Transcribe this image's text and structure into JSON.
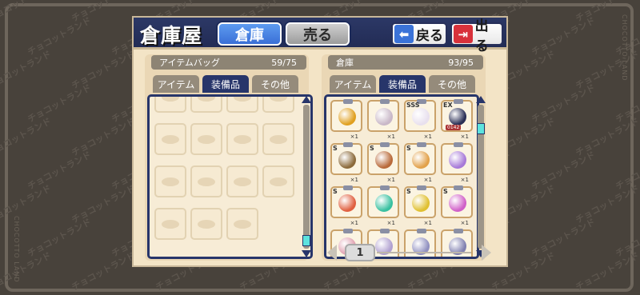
{
  "header": {
    "title": "倉庫屋",
    "tab_warehouse": "倉庫",
    "tab_sell": "売る",
    "back_label": "戻る",
    "exit_label": "出る"
  },
  "watermark": {
    "text": "チョコットランド",
    "side_text": "CHOCOTTO LAND"
  },
  "bag": {
    "title": "アイテムバッグ",
    "count": "59/75",
    "tabs": [
      "アイテム",
      "装備品",
      "その他"
    ],
    "active_tab": "装備品",
    "empty_slots": 15
  },
  "storage": {
    "title": "倉庫",
    "count": "93/95",
    "tabs": [
      "アイテム",
      "装備品",
      "その他"
    ],
    "active_tab": "装備品",
    "items": [
      {
        "rank": "",
        "qty": "×1",
        "icon": "torii-gate-icon",
        "color": "#e0a020"
      },
      {
        "rank": "",
        "qty": "×1",
        "icon": "horned-helmet-icon",
        "color": "#c9b8c8"
      },
      {
        "rank": "SSS",
        "qty": "×1",
        "icon": "white-creature-icon",
        "color": "#e8e0ee"
      },
      {
        "rank": "EX",
        "qty": "×1",
        "sub": "0142",
        "icon": "black-wing-icon",
        "color": "#2a2f55"
      },
      {
        "rank": "S",
        "qty": "×1",
        "icon": "branch-weapon-icon",
        "color": "#8c6b3c"
      },
      {
        "rank": "S",
        "qty": "×1",
        "icon": "wooden-shield-icon",
        "color": "#b96a3a"
      },
      {
        "rank": "S",
        "qty": "×1",
        "icon": "flame-ring-icon",
        "color": "#e2a14a"
      },
      {
        "rank": "",
        "qty": "×1",
        "icon": "purple-armor-icon",
        "color": "#a77ad8"
      },
      {
        "rank": "S",
        "qty": "×1",
        "icon": "rainbow-orb-icon",
        "color": "#e06040"
      },
      {
        "rank": "",
        "qty": "×1",
        "icon": "green-gem-icon",
        "color": "#38c0a0"
      },
      {
        "rank": "S",
        "qty": "×1",
        "icon": "gold-gem-icon",
        "color": "#e0c030"
      },
      {
        "rank": "S",
        "qty": "×1",
        "icon": "pink-gem-icon",
        "color": "#d060c8"
      },
      {
        "rank": "",
        "qty": "",
        "icon": "partial-item-icon",
        "color": "#e0a0b0"
      },
      {
        "rank": "",
        "qty": "",
        "icon": "partial-item-icon",
        "color": "#b0a0d0"
      },
      {
        "rank": "",
        "qty": "",
        "icon": "partial-item-icon",
        "color": "#9090c0"
      },
      {
        "rank": "",
        "qty": "",
        "icon": "partial-item-icon",
        "color": "#8080b0"
      }
    ]
  },
  "pager": {
    "page": "1"
  },
  "colors": {
    "navy": "#27356a",
    "accent_blue": "#3a6fd6",
    "exit_red": "#d8313b",
    "scroll_thumb": "#5de3de"
  }
}
